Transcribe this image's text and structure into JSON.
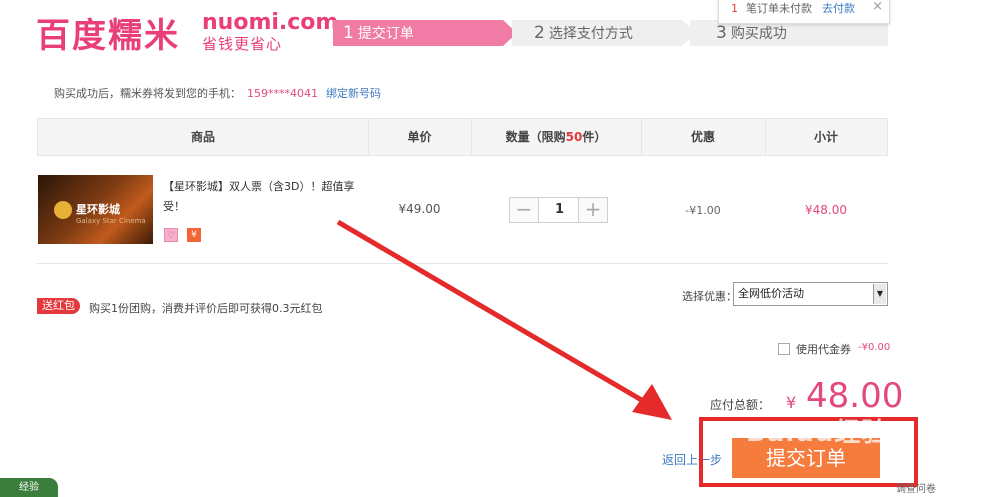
{
  "logo": {
    "cn": "百度糯米",
    "en": "nuomi.com",
    "slogan": "省钱更省心"
  },
  "steps": [
    {
      "num": "1",
      "label": "提交订单",
      "active": true
    },
    {
      "num": "2",
      "label": "选择支付方式",
      "active": false
    },
    {
      "num": "3",
      "label": "购买成功",
      "active": false
    }
  ],
  "notice": {
    "count": "1",
    "text": "笔订单未付款",
    "link": "去付款",
    "close": "×"
  },
  "phone": {
    "label": "购买成功后，糯米券将发到您的手机：",
    "number": "159****4041",
    "bind_link": "绑定新号码"
  },
  "table": {
    "headers": {
      "product": "商品",
      "unit_price": "单价",
      "qty_prefix": "数量（限购",
      "qty_limit": "50",
      "qty_suffix": "件）",
      "discount": "优惠",
      "subtotal": "小计"
    },
    "row": {
      "image_brand": "星环影城",
      "image_sub": "Galaxy Star Cinema",
      "name": "【星环影城】双人票（含3D）！超值享受！",
      "unit_price": "¥49.00",
      "quantity": "1",
      "minus": "−",
      "plus": "+",
      "discount": "-¥1.00",
      "subtotal": "¥48.00"
    }
  },
  "redpack": {
    "tag": "送红包",
    "text": "购买1份团购，消费并评价后即可获得0.3元红包"
  },
  "promo": {
    "label": "选择优惠：",
    "selected": "全网低价活动"
  },
  "voucher": {
    "label": "使用代金券",
    "amount": "-¥0.00"
  },
  "total": {
    "label": "应付总额：",
    "symbol": "¥",
    "amount": "48.00"
  },
  "actions": {
    "back": "返回上一步",
    "submit": "提交订单"
  },
  "survey": "调查问卷",
  "watermark": "Baidu经验",
  "corner_widget": "经验",
  "colors": {
    "brand_pink": "#ea3e7b",
    "step_active": "#f07ca6",
    "price_red": "#e4497e",
    "submit_orange": "#f57c3d",
    "annotation_red": "#e42a2a"
  }
}
